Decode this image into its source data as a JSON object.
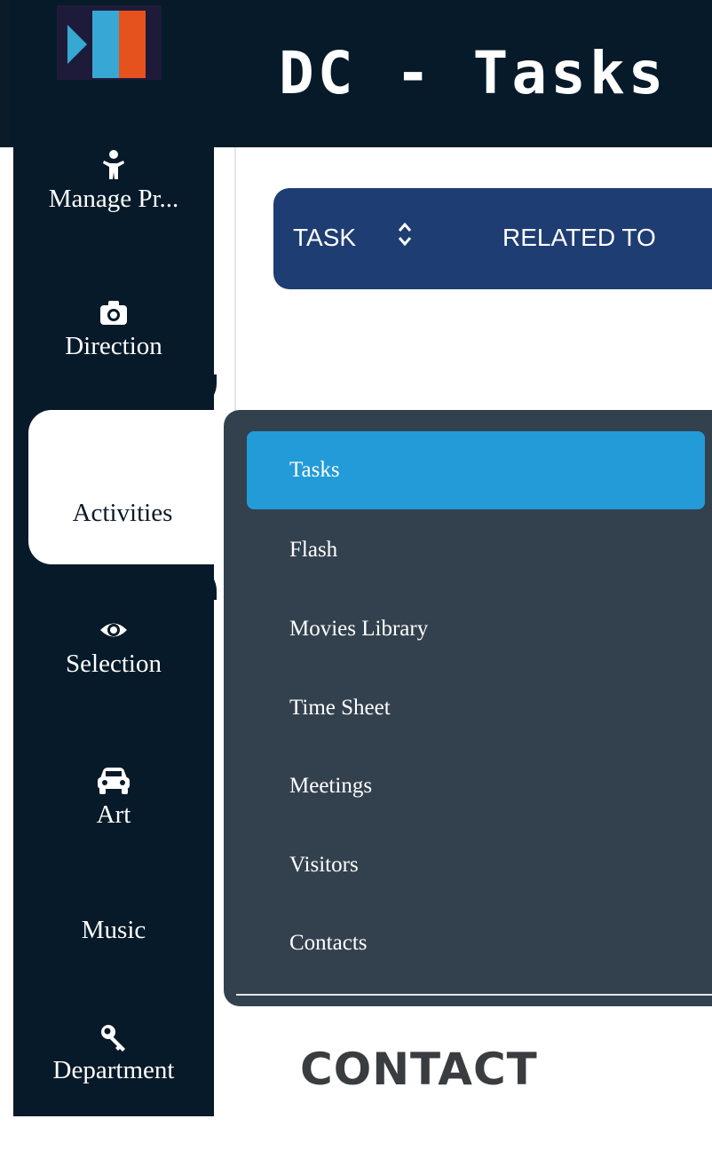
{
  "header": {
    "title": "DC - Tasks"
  },
  "sidebar": {
    "items": [
      {
        "label": "Manage Pr...",
        "icon": "person-icon"
      },
      {
        "label": "Direction",
        "icon": "camera-icon"
      },
      {
        "label": "Activities",
        "icon": "",
        "active": true
      },
      {
        "label": "Selection",
        "icon": "eye-icon"
      },
      {
        "label": "Art",
        "icon": "car-icon"
      },
      {
        "label": "Music",
        "icon": ""
      },
      {
        "label": "Department",
        "icon": "key-icon"
      }
    ]
  },
  "table": {
    "columns": [
      "TASK",
      "RELATED TO"
    ]
  },
  "submenu": {
    "items": [
      {
        "label": "Tasks",
        "active": true
      },
      {
        "label": "Flash"
      },
      {
        "label": "Movies Library"
      },
      {
        "label": "Time Sheet"
      },
      {
        "label": "Meetings"
      },
      {
        "label": "Visitors"
      },
      {
        "label": "Contacts"
      }
    ]
  },
  "section": {
    "heading": "CONTACT"
  },
  "colors": {
    "header_bg": "#071a29",
    "table_header_bg": "#1e3d72",
    "submenu_bg": "#33414f",
    "submenu_active": "#239bd8",
    "logo_blue": "#37a8d3",
    "logo_orange": "#e5521e"
  }
}
